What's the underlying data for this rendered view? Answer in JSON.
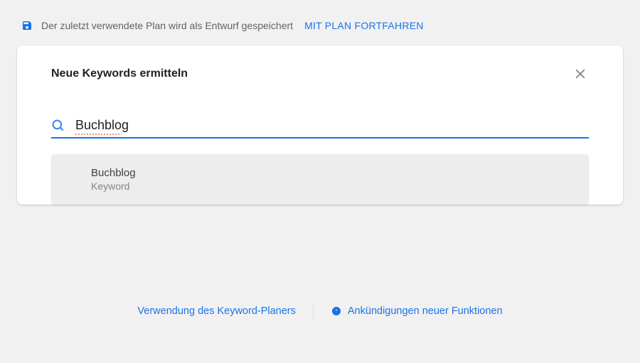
{
  "banner": {
    "message": "Der zuletzt verwendete Plan wird als Entwurf gespeichert",
    "link_label": "MIT PLAN FORTFAHREN"
  },
  "modal": {
    "title": "Neue Keywords ermitteln",
    "search_value": "Buchblog",
    "suggestion": {
      "title": "Buchblog",
      "subtitle": "Keyword"
    }
  },
  "footer": {
    "usage_label": "Verwendung des Keyword-Planers",
    "announcements_label": "Ankündigungen neuer Funktionen"
  }
}
